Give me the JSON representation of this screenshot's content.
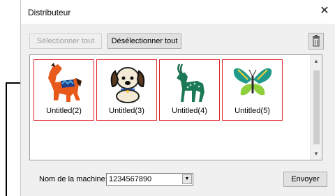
{
  "window": {
    "title": "Distributeur",
    "close_glyph": "✕"
  },
  "toolbar": {
    "select_all_label": "Sélectionner tout",
    "deselect_all_label": "Désélectionner tout",
    "delete_icon": "trash-icon"
  },
  "designs": [
    {
      "caption": "Untitled(2)",
      "icon": "horse-icon"
    },
    {
      "caption": "Untitled(3)",
      "icon": "puppy-icon"
    },
    {
      "caption": "Untitled(4)",
      "icon": "antelope-icon"
    },
    {
      "caption": "Untitled(5)",
      "icon": "butterfly-icon"
    }
  ],
  "machine": {
    "label": "Nom de la machine:",
    "value": "1234567890"
  },
  "send_label": "Envoyer",
  "colors": {
    "selection_border": "#e0262b",
    "accent": "#0078d7"
  }
}
